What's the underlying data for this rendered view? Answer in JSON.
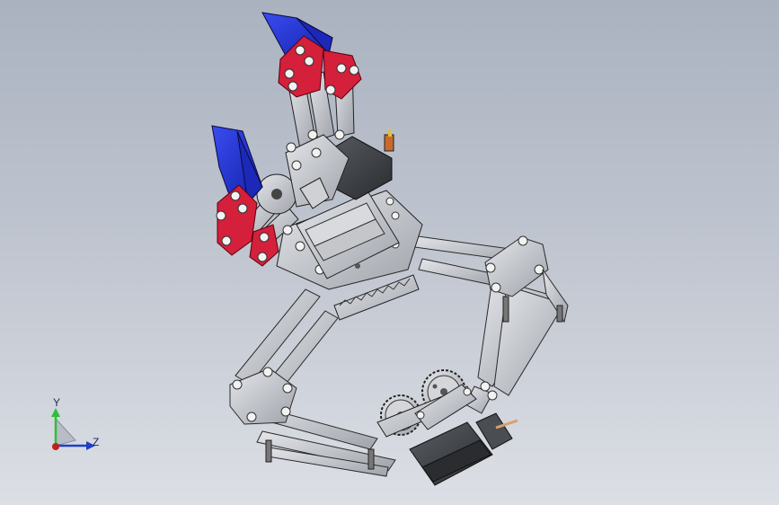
{
  "viewport": {
    "background_top": "#aab2c0",
    "background_bottom": "#dcdfe5",
    "model_name": "robotic-gripper-arm-assembly"
  },
  "colors": {
    "gripper_finger": "#1f2fd8",
    "finger_plate": "#d4203a",
    "frame_metal": "#c9cbcf",
    "motor_body": "#3c3f44"
  },
  "triad": {
    "y_label": "Y",
    "z_label": "Z",
    "y_color": "#2fbf3a",
    "z_color": "#1f3fc8",
    "origin_color": "#c02020"
  }
}
